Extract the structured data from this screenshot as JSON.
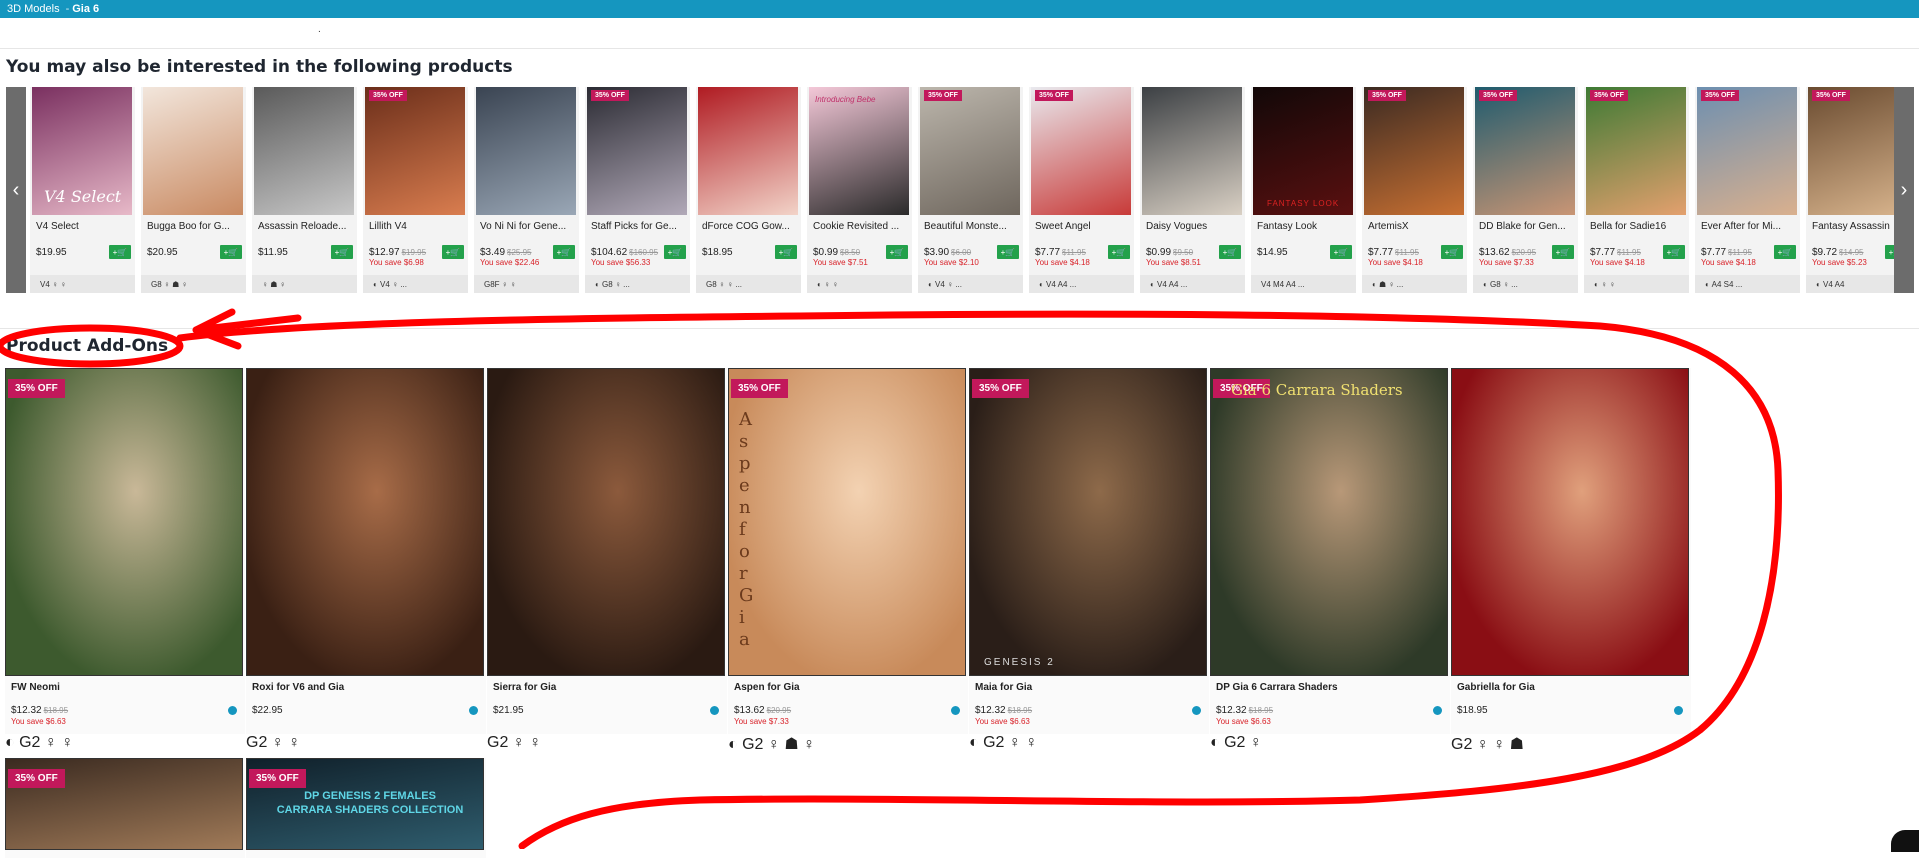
{
  "breadcrumb": {
    "parent": "3D Models",
    "separator": "-",
    "current": "Gia 6"
  },
  "sections": {
    "related_title": "You may also be interested in the following products",
    "addons_title": "Product Add-Ons"
  },
  "carousel": {
    "prev_label": "‹",
    "next_label": "›",
    "cart_label": "+🛒",
    "items": [
      {
        "name": "V4 Select",
        "price": "$19.95",
        "was": "",
        "save": "",
        "badge": "",
        "tags": "V4  ♀  ♀",
        "c1": "#7a3060",
        "c2": "#e7b9c8"
      },
      {
        "name": "Bugga Boo for G...",
        "price": "$20.95",
        "was": "",
        "save": "",
        "badge": "",
        "tags": "G8  ♀  ☗  ♀",
        "c1": "#f2e6dc",
        "c2": "#c98a62"
      },
      {
        "name": "Assassin Reloade...",
        "price": "$11.95",
        "was": "",
        "save": "",
        "badge": "",
        "tags": "♀  ☗  ♀",
        "c1": "#5a5a5a",
        "c2": "#c7c7c7"
      },
      {
        "name": "Lillith V4",
        "price": "$12.97",
        "was": "$19.95",
        "save": "You save $6.98",
        "badge": "35% OFF",
        "tags": "◐  V4  ♀  ...",
        "c1": "#6b2e1a",
        "c2": "#d97d4f"
      },
      {
        "name": "Vo Ni Ni for Gene...",
        "price": "$3.49",
        "was": "$25.95",
        "save": "You save $22.46",
        "badge": "",
        "tags": "G8F  ♀  ♀",
        "c1": "#3a4452",
        "c2": "#9aa7b6"
      },
      {
        "name": "Staff Picks for Ge...",
        "price": "$104.62",
        "was": "$160.95",
        "save": "You save $56.33",
        "badge": "35% OFF",
        "tags": "◐  G8  ♀  ...",
        "c1": "#2b2b33",
        "c2": "#b1a9b8"
      },
      {
        "name": "dForce COG Gow...",
        "price": "$18.95",
        "was": "",
        "save": "",
        "badge": "",
        "tags": "G8  ♀  ♀  ...",
        "c1": "#b01b22",
        "c2": "#f2d3c8"
      },
      {
        "name": "Cookie Revisited ...",
        "price": "$0.99",
        "was": "$8.50",
        "save": "You save $7.51",
        "badge": "",
        "tags": "◐  ♀  ♀",
        "c1": "#f4c8d8",
        "c2": "#2a2a2a"
      },
      {
        "name": "Beautiful Monste...",
        "price": "$3.90",
        "was": "$6.00",
        "save": "You save $2.10",
        "badge": "35% OFF",
        "tags": "◐  V4  ♀  ...",
        "c1": "#bcb6ac",
        "c2": "#6e665d"
      },
      {
        "name": "Sweet Angel",
        "price": "$7.77",
        "was": "$11.95",
        "save": "You save $4.18",
        "badge": "35% OFF",
        "tags": "◐  V4  A4  ...",
        "c1": "#e9e9ee",
        "c2": "#c83a38"
      },
      {
        "name": "Daisy Vogues",
        "price": "$0.99",
        "was": "$9.50",
        "save": "You save $8.51",
        "badge": "",
        "tags": "◐  V4  A4  ...",
        "c1": "#3c4044",
        "c2": "#d9d0c4"
      },
      {
        "name": "Fantasy Look",
        "price": "$14.95",
        "was": "",
        "save": "",
        "badge": "",
        "tags": "V4  M4  A4  ...",
        "c1": "#120808",
        "c2": "#5a1010"
      },
      {
        "name": "ArtemisX",
        "price": "$7.77",
        "was": "$11.95",
        "save": "You save $4.18",
        "badge": "35% OFF",
        "tags": "◐  ☗  ♀  ...",
        "c1": "#3b2a22",
        "c2": "#c87032"
      },
      {
        "name": "DD Blake for Gen...",
        "price": "$13.62",
        "was": "$20.95",
        "save": "You save $7.33",
        "badge": "35% OFF",
        "tags": "◐  G8  ♀  ...",
        "c1": "#1f5b6e",
        "c2": "#c99574"
      },
      {
        "name": "Bella for Sadie16",
        "price": "$7.77",
        "was": "$11.95",
        "save": "You save $4.18",
        "badge": "35% OFF",
        "tags": "◐  ♀  ♀",
        "c1": "#3e7a34",
        "c2": "#e3a06e"
      },
      {
        "name": "Ever After for Mi...",
        "price": "$7.77",
        "was": "$11.95",
        "save": "You save $4.18",
        "badge": "35% OFF",
        "tags": "◐  A4  S4  ...",
        "c1": "#6d8fb0",
        "c2": "#d9b08e"
      },
      {
        "name": "Fantasy Assassin",
        "price": "$9.72",
        "was": "$14.95",
        "save": "You save $5.23",
        "badge": "35% OFF",
        "tags": "◐  V4  A4",
        "c1": "#6a4b30",
        "c2": "#d8b48d"
      }
    ]
  },
  "addons": {
    "items": [
      {
        "name": "FW Neomi",
        "price": "$12.32",
        "was": "$18.95",
        "save": "You save $6.63",
        "badge": "35% OFF",
        "tags": "◐  G2  ♀  ♀",
        "c1": "#3d5a2e",
        "c2": "#c9b898"
      },
      {
        "name": "Roxi for V6 and Gia",
        "price": "$22.95",
        "was": "",
        "save": "",
        "badge": "",
        "tags": "G2  ♀  ♀",
        "c1": "#3a2014",
        "c2": "#a86c48"
      },
      {
        "name": "Sierra for Gia",
        "price": "$21.95",
        "was": "",
        "save": "",
        "badge": "",
        "tags": "G2  ♀  ♀",
        "c1": "#2a1a12",
        "c2": "#8c5a3c"
      },
      {
        "name": "Aspen for Gia",
        "price": "$13.62",
        "was": "$20.95",
        "save": "You save $7.33",
        "badge": "35% OFF",
        "tags": "◐  G2  ♀  ☗  ♀",
        "c1": "#c88a5a",
        "c2": "#f3d2b2"
      },
      {
        "name": "Maia for Gia",
        "price": "$12.32",
        "was": "$18.95",
        "save": "You save $6.63",
        "badge": "35% OFF",
        "tags": "◐  G2  ♀  ♀",
        "c1": "#2a1e18",
        "c2": "#8e6a4a"
      },
      {
        "name": "DP Gia 6 Carrara Shaders",
        "price": "$12.32",
        "was": "$18.95",
        "save": "You save $6.63",
        "badge": "35% OFF",
        "tags": "◐  G2  ♀",
        "c1": "#2e3a28",
        "c2": "#b89878"
      },
      {
        "name": "Gabriella for Gia",
        "price": "$18.95",
        "was": "",
        "save": "",
        "badge": "",
        "tags": "G2  ♀  ♀  ☗",
        "c1": "#8a0e14",
        "c2": "#e0a07c"
      }
    ],
    "row2": [
      {
        "badge": "35% OFF",
        "c1": "#3a2a20",
        "c2": "#a07a58"
      },
      {
        "badge": "35% OFF",
        "c1": "#10202a",
        "c2": "#2f5d6e"
      }
    ]
  },
  "image_text": {
    "v4_select": "V4 Select",
    "aspen_vertical": "Aspen for Gia",
    "maia_caption": "GENESIS 2",
    "carrara_title": "Gia 6 Carrara Shaders",
    "cookie_caption": "Introducing Bebe",
    "fantasy_caption": "FANTASY LOOK",
    "row2_title": "DP GENESIS 2 FEMALES CARRARA SHADERS COLLECTION"
  },
  "colors": {
    "topbar": "#1596bf",
    "sale_badge": "#c2185b",
    "cart_button": "#23a14b",
    "save_text": "#d8232a",
    "annotation": "#ff0000"
  }
}
